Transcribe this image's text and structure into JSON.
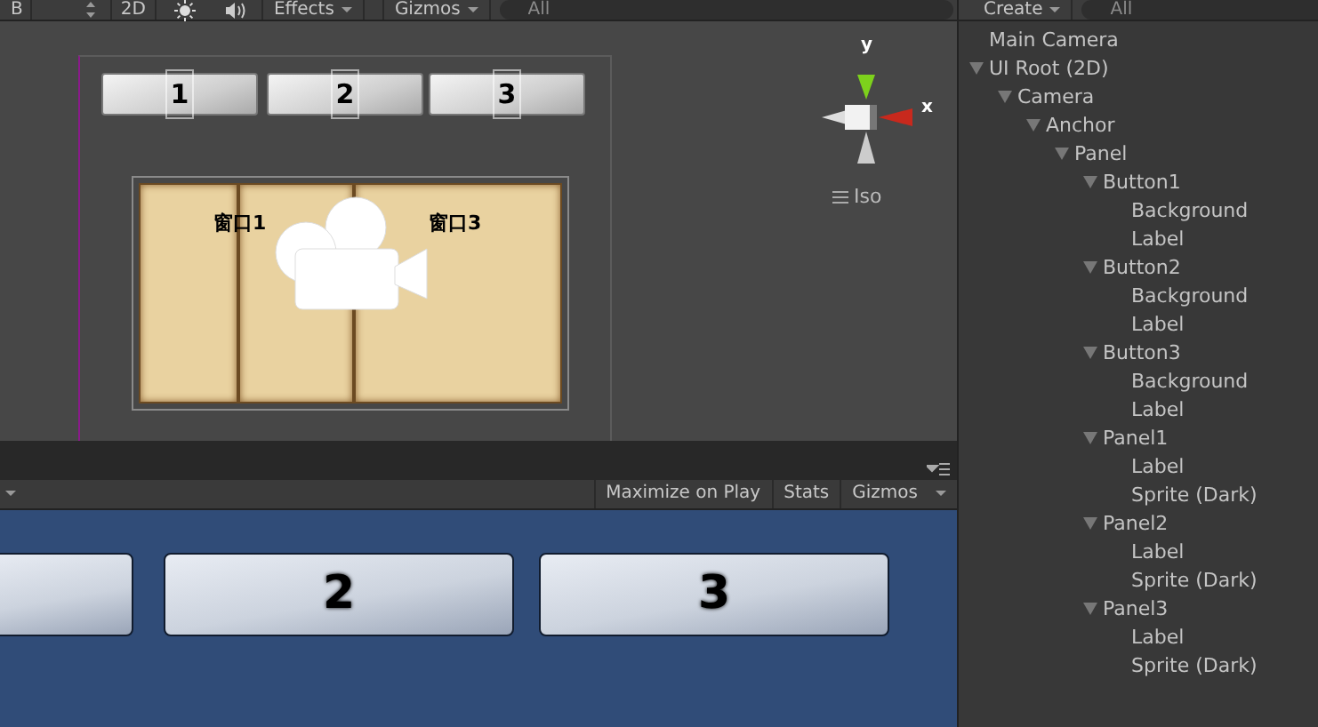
{
  "scene_toolbar": {
    "mode_label": "B",
    "toggle_2d": "2D",
    "effects": "Effects",
    "gizmos": "Gizmos",
    "search_placeholder": "All"
  },
  "scene": {
    "buttons": [
      {
        "label": "1"
      },
      {
        "label": "2"
      },
      {
        "label": "3"
      }
    ],
    "panel_labels": [
      "窗口1",
      "窗口3"
    ],
    "gizmo": {
      "y_label": "y",
      "x_label": "x",
      "projection": "Iso"
    }
  },
  "game_toolbar": {
    "buttons": [
      "Maximize on Play",
      "Stats",
      "Gizmos"
    ]
  },
  "game": {
    "buttons": [
      {
        "label": "2"
      },
      {
        "label": "3"
      }
    ]
  },
  "hierarchy": {
    "create": "Create",
    "search_placeholder": "All",
    "items": [
      {
        "label": "Main Camera"
      },
      {
        "label": "UI Root (2D)",
        "expanded": true,
        "children": [
          {
            "label": "Camera",
            "expanded": true,
            "children": [
              {
                "label": "Anchor",
                "expanded": true,
                "children": [
                  {
                    "label": "Panel",
                    "expanded": true,
                    "children": [
                      {
                        "label": "Button1",
                        "expanded": true,
                        "children": [
                          {
                            "label": "Background"
                          },
                          {
                            "label": "Label"
                          }
                        ]
                      },
                      {
                        "label": "Button2",
                        "expanded": true,
                        "children": [
                          {
                            "label": "Background"
                          },
                          {
                            "label": "Label"
                          }
                        ]
                      },
                      {
                        "label": "Button3",
                        "expanded": true,
                        "children": [
                          {
                            "label": "Background"
                          },
                          {
                            "label": "Label"
                          }
                        ]
                      },
                      {
                        "label": "Panel1",
                        "expanded": true,
                        "children": [
                          {
                            "label": "Label"
                          },
                          {
                            "label": "Sprite (Dark)"
                          }
                        ]
                      },
                      {
                        "label": "Panel2",
                        "expanded": true,
                        "children": [
                          {
                            "label": "Label"
                          },
                          {
                            "label": "Sprite (Dark)"
                          }
                        ]
                      },
                      {
                        "label": "Panel3",
                        "expanded": true,
                        "children": [
                          {
                            "label": "Label"
                          },
                          {
                            "label": "Sprite (Dark)"
                          }
                        ]
                      }
                    ]
                  }
                ]
              }
            ]
          }
        ]
      }
    ]
  }
}
